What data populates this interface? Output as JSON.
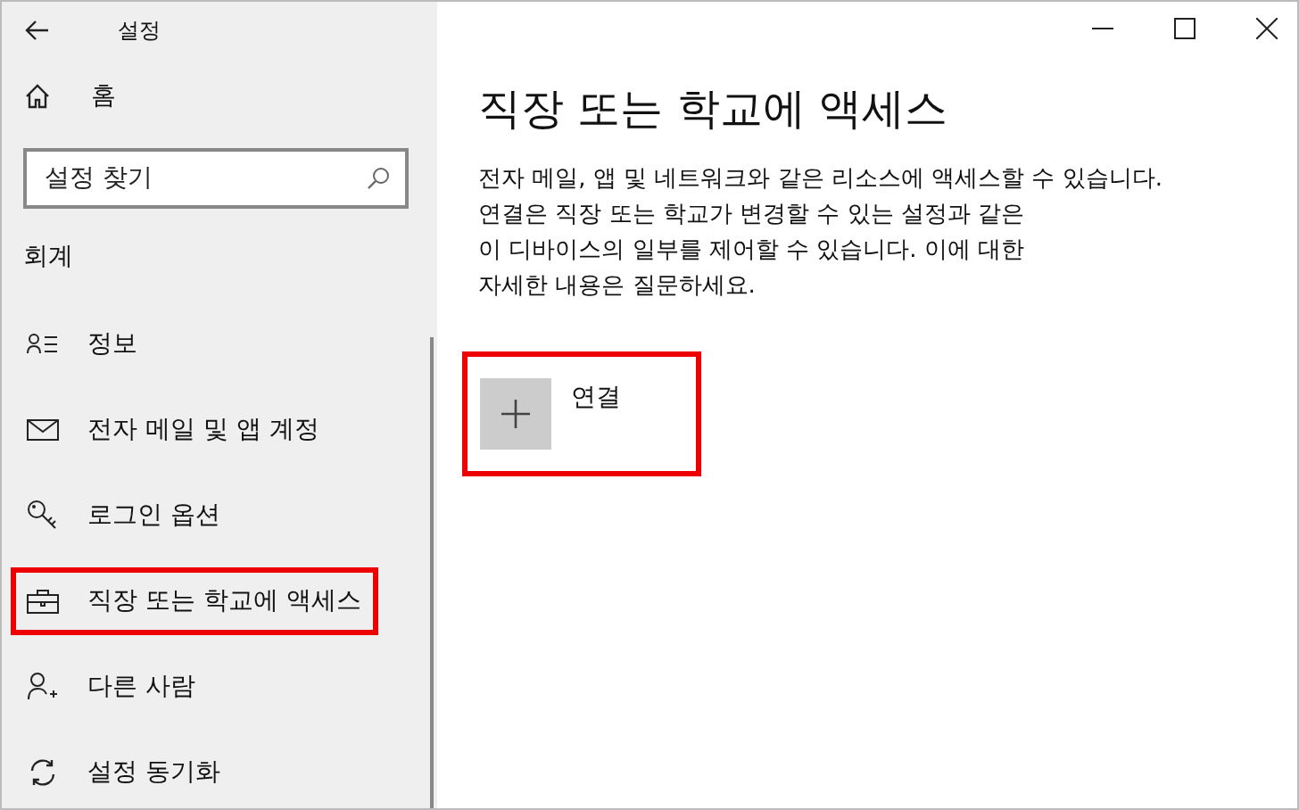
{
  "window": {
    "title": "설정"
  },
  "sidebar": {
    "home": "홈",
    "search": {
      "placeholder": "설정 찾기"
    },
    "section": "회계",
    "items": [
      {
        "label": "정보",
        "selected": false
      },
      {
        "label": "전자 메일 및 앱 계정",
        "selected": false
      },
      {
        "label": "로그인 옵션",
        "selected": false
      },
      {
        "label": "직장 또는 학교에 액세스",
        "selected": true
      },
      {
        "label": "다른 사람",
        "selected": false
      },
      {
        "label": "설정 동기화",
        "selected": false
      }
    ]
  },
  "main": {
    "title": "직장 또는 학교에 액세스",
    "description": "전자 메일, 앱 및 네트워크와 같은 리소스에 액세스할 수 있습니다.\n연결은 직장 또는 학교가 변경할 수 있는 설정과 같은\n이 디바이스의 일부를 제어할 수 있습니다. 이에 대한\n자세한 내용은 질문하세요.",
    "connect": {
      "label": "연결",
      "highlighted": true
    }
  }
}
